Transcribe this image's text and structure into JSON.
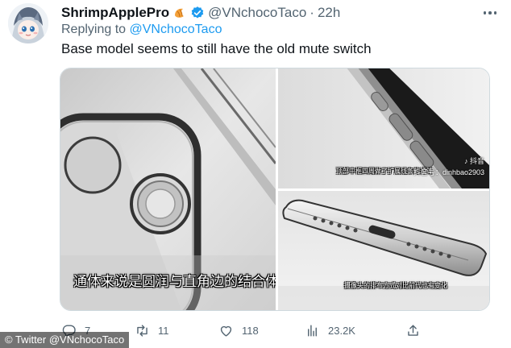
{
  "tweet": {
    "author_name": "ShrimpApplePro",
    "emoji_badge_icon": "croissant-emoji",
    "verified_icon": "verified-badge-icon",
    "handle": "@VNchocoTaco",
    "separator": "·",
    "time": "22h",
    "replying_prefix": "Replying to ",
    "replying_to": "@VNchocoTaco",
    "text": "Base model seems to still have the old mute switch"
  },
  "media": {
    "left_subtitle": "通体来说是圆润与直角边的结合体",
    "top_right_subtitle": "顶部中框四周做了扩展线条的设计",
    "bottom_right_subtitle": "摄像头的排布方式对比前代也有变化",
    "watermark_logo": "♪ 抖音",
    "watermark_id": "抖音号：dinhbao2903"
  },
  "actions": {
    "replies": "7",
    "retweets": "11",
    "likes": "118",
    "views": "23.2K"
  },
  "credit": "© Twitter @VNchocoTaco",
  "colors": {
    "accent": "#1d9bf0",
    "secondary_text": "#536471",
    "primary_text": "#0f1419"
  }
}
